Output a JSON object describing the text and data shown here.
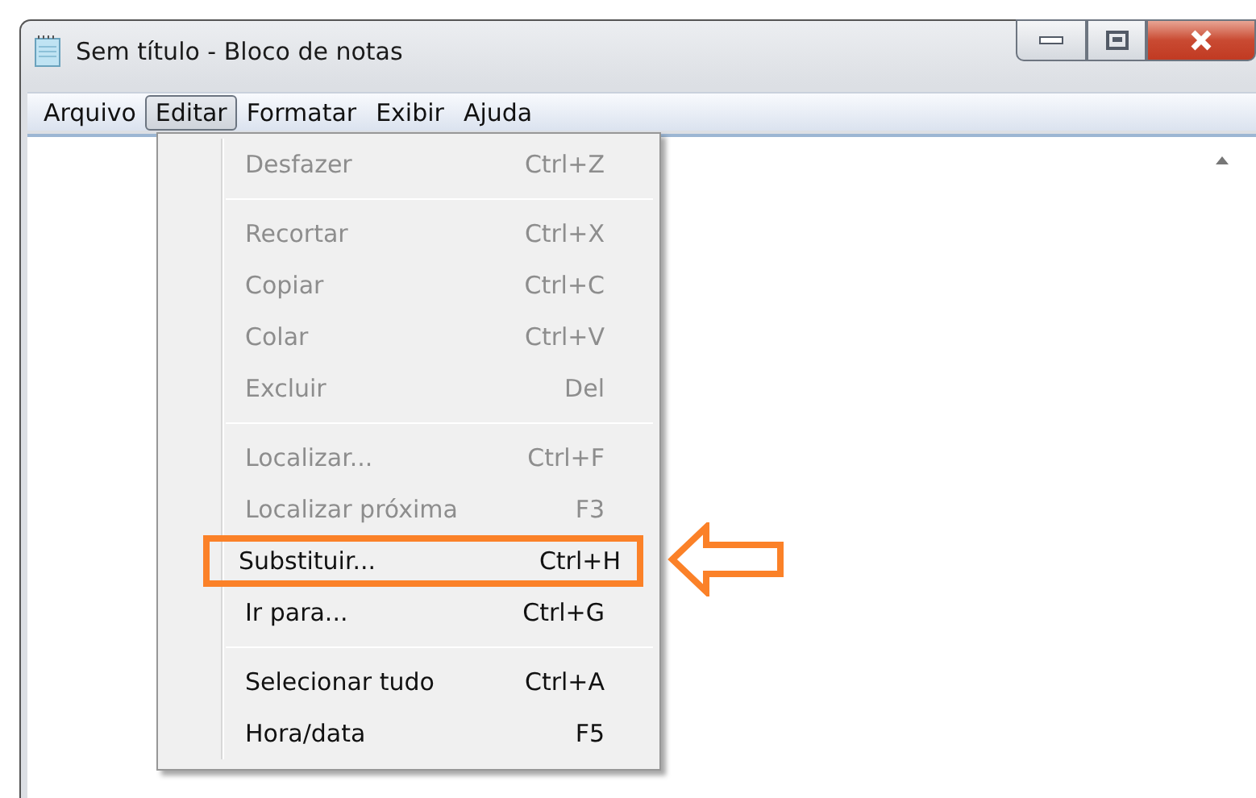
{
  "window": {
    "title": "Sem título - Bloco de notas"
  },
  "menu_bar": [
    {
      "label": "Arquivo",
      "selected": false
    },
    {
      "label": "Editar",
      "selected": true
    },
    {
      "label": "Formatar",
      "selected": false
    },
    {
      "label": "Exibir",
      "selected": false
    },
    {
      "label": "Ajuda",
      "selected": false
    }
  ],
  "edit_menu": [
    {
      "kind": "item",
      "label": "Desfazer",
      "shortcut": "Ctrl+Z",
      "disabled": true,
      "callout": false
    },
    {
      "kind": "separator"
    },
    {
      "kind": "item",
      "label": "Recortar",
      "shortcut": "Ctrl+X",
      "disabled": true,
      "callout": false
    },
    {
      "kind": "item",
      "label": "Copiar",
      "shortcut": "Ctrl+C",
      "disabled": true,
      "callout": false
    },
    {
      "kind": "item",
      "label": "Colar",
      "shortcut": "Ctrl+V",
      "disabled": true,
      "callout": false
    },
    {
      "kind": "item",
      "label": "Excluir",
      "shortcut": "Del",
      "disabled": true,
      "callout": false
    },
    {
      "kind": "separator"
    },
    {
      "kind": "item",
      "label": "Localizar...",
      "shortcut": "Ctrl+F",
      "disabled": true,
      "callout": false
    },
    {
      "kind": "item",
      "label": "Localizar próxima",
      "shortcut": "F3",
      "disabled": true,
      "callout": false
    },
    {
      "kind": "item",
      "label": "Substituir...",
      "shortcut": "Ctrl+H",
      "disabled": false,
      "callout": true
    },
    {
      "kind": "item",
      "label": "Ir para...",
      "shortcut": "Ctrl+G",
      "disabled": false,
      "callout": false
    },
    {
      "kind": "separator"
    },
    {
      "kind": "item",
      "label": "Selecionar tudo",
      "shortcut": "Ctrl+A",
      "disabled": false,
      "callout": false
    },
    {
      "kind": "item",
      "label": "Hora/data",
      "shortcut": "F5",
      "disabled": false,
      "callout": false
    }
  ]
}
